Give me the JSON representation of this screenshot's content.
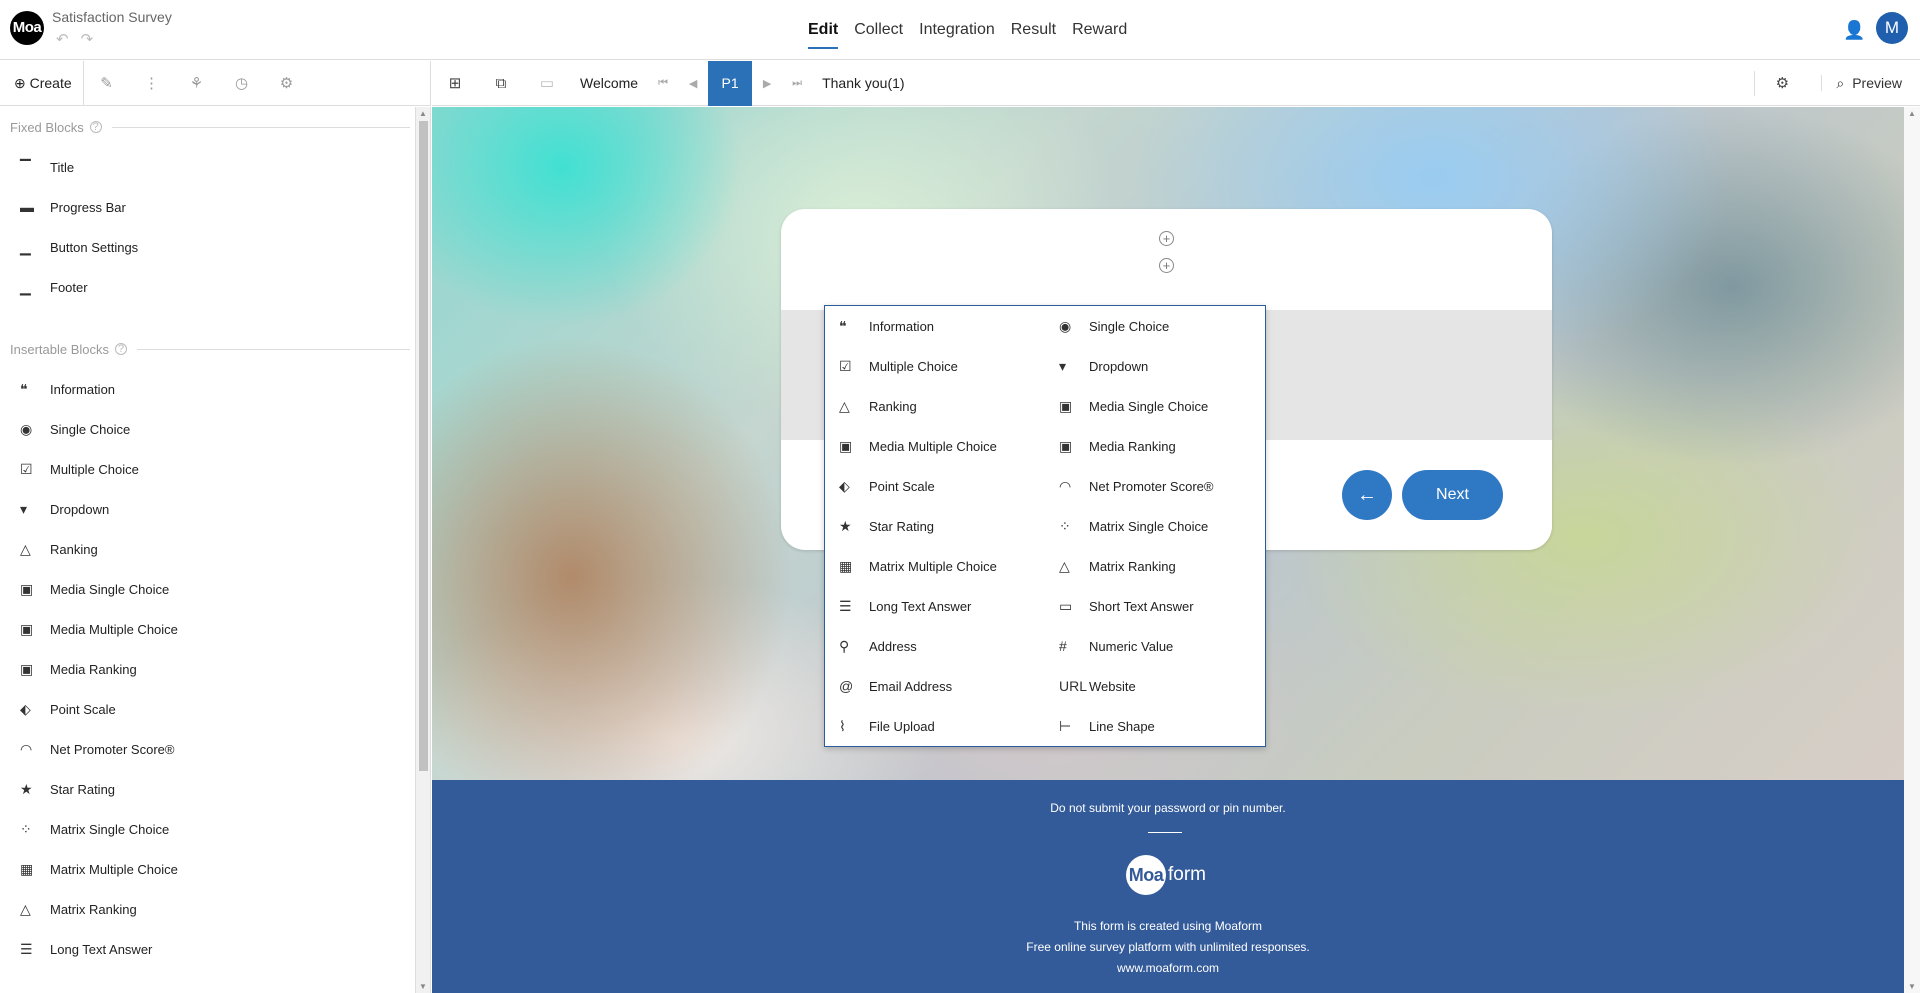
{
  "app": {
    "logo_text": "Moa",
    "survey_title": "Satisfaction Survey"
  },
  "main_tabs": [
    {
      "label": "Edit",
      "active": true
    },
    {
      "label": "Collect"
    },
    {
      "label": "Integration"
    },
    {
      "label": "Result"
    },
    {
      "label": "Reward"
    }
  ],
  "user": {
    "avatar_initial": "M"
  },
  "left_toolbar": {
    "create_label": "Create"
  },
  "sidebar": {
    "fixed_header": "Fixed Blocks",
    "fixed_items": [
      {
        "label": "Title",
        "icon": "title-icon",
        "glyph": "▔"
      },
      {
        "label": "Progress Bar",
        "icon": "progress-bar-icon",
        "glyph": "▬"
      },
      {
        "label": "Button Settings",
        "icon": "button-settings-icon",
        "glyph": "▁"
      },
      {
        "label": "Footer",
        "icon": "footer-icon",
        "glyph": "▁"
      }
    ],
    "insertable_header": "Insertable Blocks",
    "insertable_items": [
      {
        "label": "Information",
        "icon": "quote-icon",
        "glyph": "❝"
      },
      {
        "label": "Single Choice",
        "icon": "radio-icon",
        "glyph": "◉"
      },
      {
        "label": "Multiple Choice",
        "icon": "checkbox-icon",
        "glyph": "☑"
      },
      {
        "label": "Dropdown",
        "icon": "dropdown-icon",
        "glyph": "▾"
      },
      {
        "label": "Ranking",
        "icon": "triangle-icon",
        "glyph": "△"
      },
      {
        "label": "Media Single Choice",
        "icon": "media-single-icon",
        "glyph": "▣"
      },
      {
        "label": "Media Multiple Choice",
        "icon": "media-multiple-icon",
        "glyph": "▣"
      },
      {
        "label": "Media Ranking",
        "icon": "media-ranking-icon",
        "glyph": "▣"
      },
      {
        "label": "Point Scale",
        "icon": "ruler-icon",
        "glyph": "⬖"
      },
      {
        "label": "Net Promoter Score®",
        "icon": "gauge-icon",
        "glyph": "◠"
      },
      {
        "label": "Star Rating",
        "icon": "star-icon",
        "glyph": "★"
      },
      {
        "label": "Matrix Single Choice",
        "icon": "matrix-single-icon",
        "glyph": "⁘"
      },
      {
        "label": "Matrix Multiple Choice",
        "icon": "matrix-multiple-icon",
        "glyph": "▦"
      },
      {
        "label": "Matrix Ranking",
        "icon": "matrix-ranking-icon",
        "glyph": "△"
      },
      {
        "label": "Long Text Answer",
        "icon": "long-text-icon",
        "glyph": "☰"
      }
    ]
  },
  "page_toolbar": {
    "welcome": "Welcome",
    "current_page": "P1",
    "thank_you": "Thank you(1)",
    "preview": "Preview"
  },
  "card": {
    "next_label": "Next"
  },
  "popup_items": [
    {
      "label": "Information",
      "icon": "quote-icon",
      "glyph": "❝"
    },
    {
      "label": "Single Choice",
      "icon": "radio-icon",
      "glyph": "◉"
    },
    {
      "label": "Multiple Choice",
      "icon": "checkbox-icon",
      "glyph": "☑"
    },
    {
      "label": "Dropdown",
      "icon": "dropdown-icon",
      "glyph": "▾"
    },
    {
      "label": "Ranking",
      "icon": "triangle-icon",
      "glyph": "△"
    },
    {
      "label": "Media Single Choice",
      "icon": "media-single-icon",
      "glyph": "▣"
    },
    {
      "label": "Media Multiple Choice",
      "icon": "media-multiple-icon",
      "glyph": "▣"
    },
    {
      "label": "Media Ranking",
      "icon": "media-ranking-icon",
      "glyph": "▣"
    },
    {
      "label": "Point Scale",
      "icon": "ruler-icon",
      "glyph": "⬖"
    },
    {
      "label": "Net Promoter Score®",
      "icon": "gauge-icon",
      "glyph": "◠"
    },
    {
      "label": "Star Rating",
      "icon": "star-icon",
      "glyph": "★"
    },
    {
      "label": "Matrix Single Choice",
      "icon": "matrix-single-icon",
      "glyph": "⁘"
    },
    {
      "label": "Matrix Multiple Choice",
      "icon": "matrix-multiple-icon",
      "glyph": "▦"
    },
    {
      "label": "Matrix Ranking",
      "icon": "matrix-ranking-icon",
      "glyph": "△"
    },
    {
      "label": "Long Text Answer",
      "icon": "long-text-icon",
      "glyph": "☰"
    },
    {
      "label": "Short Text Answer",
      "icon": "short-text-icon",
      "glyph": "▭"
    },
    {
      "label": "Address",
      "icon": "location-pin-icon",
      "glyph": "⚲"
    },
    {
      "label": "Numeric Value",
      "icon": "hash-icon",
      "glyph": "#"
    },
    {
      "label": "Email Address",
      "icon": "at-icon",
      "glyph": "@"
    },
    {
      "label": "Website",
      "icon": "url-icon",
      "glyph": "URL"
    },
    {
      "label": "File Upload",
      "icon": "paperclip-icon",
      "glyph": "⌇"
    },
    {
      "label": "Line Shape",
      "icon": "line-shape-icon",
      "glyph": "⊢"
    }
  ],
  "footer": {
    "warning": "Do not submit your password or pin number.",
    "brand_circle": "Moa",
    "brand_word": "form",
    "line1": "This form is created using Moaform",
    "line2": "Free online survey platform with unlimited responses.",
    "line3": "www.moaform.com"
  },
  "colors": {
    "accent": "#2b71b8",
    "footer_bg": "#335a99",
    "button": "#2f78c4"
  }
}
